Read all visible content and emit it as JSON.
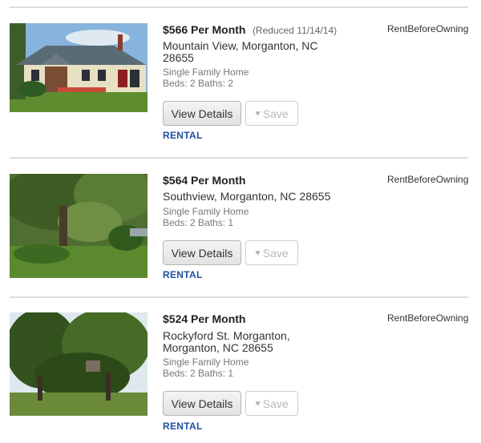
{
  "listings": [
    {
      "price": "$566 Per Month",
      "reduced": "(Reduced 11/14/14)",
      "address": "Mountain View, Morganton, NC 28655",
      "property_type": "Single Family Home",
      "beds_baths": "Beds: 2 Baths: 2",
      "view_label": "View Details",
      "save_label": "Save",
      "tag": "RENTAL",
      "source": "RentBeforeOwning"
    },
    {
      "price": "$564 Per Month",
      "reduced": "",
      "address": "Southview, Morganton, NC 28655",
      "property_type": "Single Family Home",
      "beds_baths": "Beds: 2 Baths: 1",
      "view_label": "View Details",
      "save_label": "Save",
      "tag": "RENTAL",
      "source": "RentBeforeOwning"
    },
    {
      "price": "$524 Per Month",
      "reduced": "",
      "address": "Rockyford St. Morganton, Morganton, NC 28655",
      "property_type": "Single Family Home",
      "beds_baths": "Beds: 2 Baths: 1",
      "view_label": "View Details",
      "save_label": "Save",
      "tag": "RENTAL",
      "source": "RentBeforeOwning"
    }
  ],
  "icons": {
    "save": "heart-icon"
  },
  "colors": {
    "rental_tag": "#1f4fa0",
    "divider": "#dcdcdc"
  }
}
